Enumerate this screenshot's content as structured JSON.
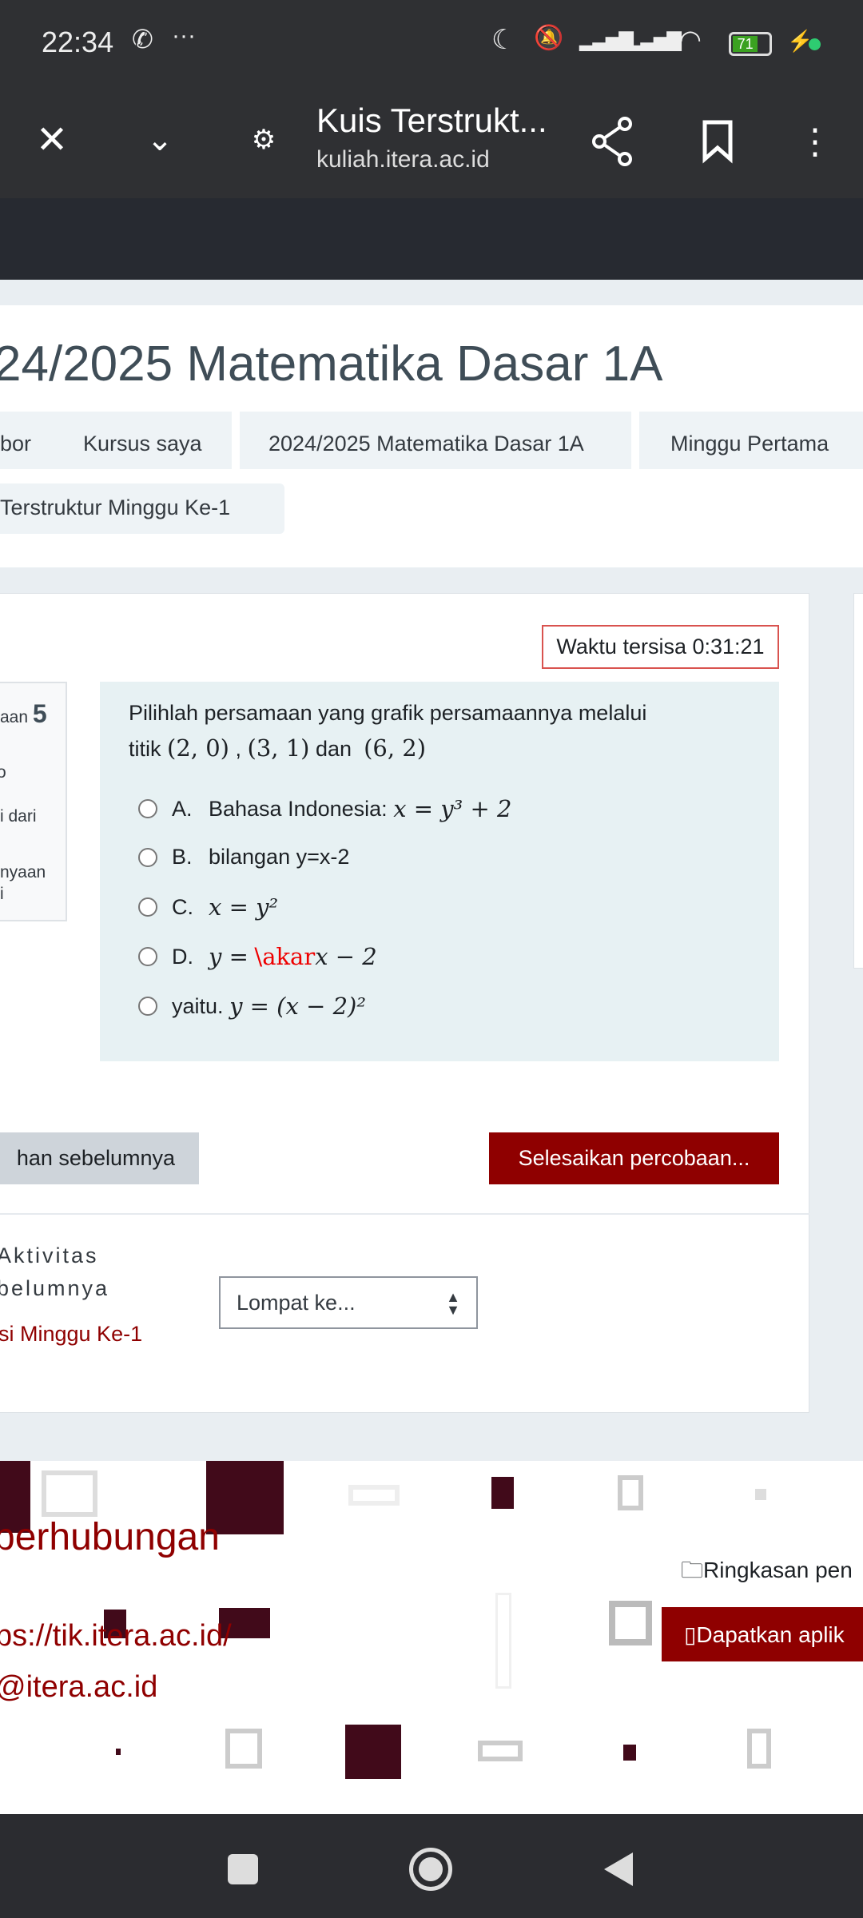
{
  "status_bar": {
    "time": "22:34",
    "battery": "71"
  },
  "browser": {
    "title": "Kuis Terstrukt...",
    "url": "kuliah.itera.ac.id"
  },
  "page": {
    "title": "24/2025 Matematika Dasar 1A",
    "breadcrumbs": [
      "bor",
      "Kursus saya",
      "2024/2025 Matematika Dasar 1A",
      "Minggu Pertama",
      "Terstruktur Minggu Ke-1"
    ]
  },
  "quiz": {
    "timer": "Waktu tersisa 0:31:21",
    "info": {
      "label": "aan",
      "number": "5",
      "line2": "o",
      "line3": "i dari",
      "line4": "nyaan",
      "line5": "i"
    },
    "question_line1": "Pilihlah persamaan yang grafik persamaannya melalui",
    "question_prefix": "titik",
    "p1": "(2, 0)",
    "sep": ",",
    "p2": "(3, 1)",
    "and": "dan",
    "p3": "(6, 2)",
    "options": [
      {
        "label": "A.",
        "text": "Bahasa Indonesia:",
        "math": "x = y³ + 2"
      },
      {
        "label": "B.",
        "text": "bilangan y=x-2",
        "math": ""
      },
      {
        "label": "C.",
        "text": "",
        "math": "x = y²"
      },
      {
        "label": "D.",
        "text": "",
        "math_pre": "y = ",
        "math_err": "\\akar",
        "math_post": "x − 2"
      },
      {
        "label": "",
        "text": "yaitu.",
        "math": "y = (x − 2)²"
      }
    ],
    "prev_button": "han sebelumnya",
    "finish_button": "Selesaikan percobaan...",
    "activity_line1": "Aktivitas",
    "activity_line2": "belumnya",
    "activity_link": "si Minggu Ke-1",
    "jump_select": "Lompat ke..."
  },
  "footer": {
    "heading": "berhubungan",
    "url": "ps://tik.itera.ac.id/",
    "email": "@itera.ac.id",
    "summary_link": "Ringkasan pen",
    "app_button": "Dapatkan aplik"
  },
  "colors": {
    "brand": "#8f0000",
    "dark_square": "#410a1a",
    "question_bg": "#e7f1f3"
  }
}
